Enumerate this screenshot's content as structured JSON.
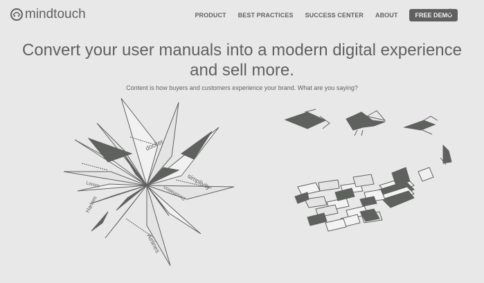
{
  "brand": {
    "name": "mindtouch",
    "text_color": "#5f615f",
    "background": "#e8e8e8"
  },
  "nav": {
    "items": [
      {
        "label": "PRODUCT"
      },
      {
        "label": "BEST PRACTICES"
      },
      {
        "label": "SUCCESS CENTER"
      },
      {
        "label": "ABOUT"
      }
    ],
    "cta_label": "FREE DEMO",
    "search_icon": "search-icon"
  },
  "hero": {
    "title_line1": "Convert your user manuals into a modern digital experience",
    "title_line2": "and sell more.",
    "subtitle": "Content is how buyers and customers experience your brand. What are you saying?"
  },
  "illustration": {
    "star_labels": [
      "docker",
      "simplivity",
      "Airlines",
      "Harlem",
      "Lorem",
      "Destination"
    ],
    "icons": [
      "paper-star-icon",
      "paper-plane-icon",
      "paper-bird-icon",
      "paper-crane-icon",
      "book-stack-icon",
      "scattered-pages-icon"
    ]
  }
}
